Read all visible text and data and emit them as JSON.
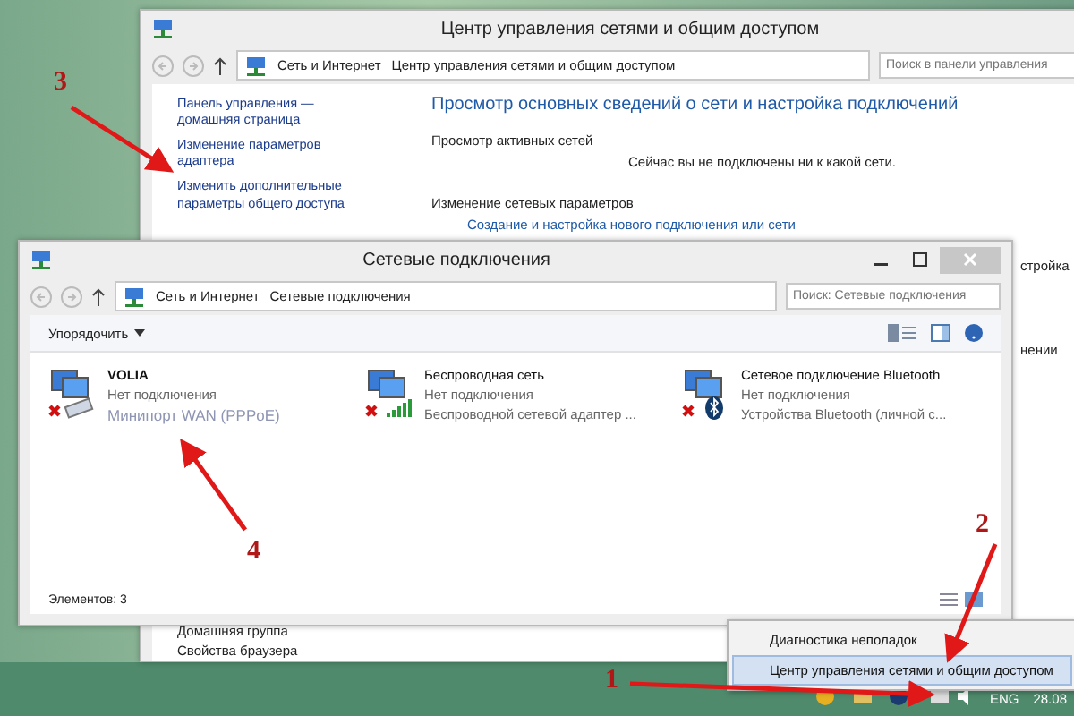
{
  "back_window": {
    "title": "Центр управления сетями и общим доступом",
    "path": [
      "Сеть и Интернет",
      "Центр управления сетями и общим доступом"
    ],
    "search_placeholder": "Поиск в панели управления",
    "sidebar": [
      {
        "label": "Панель управления — домашняя страница"
      },
      {
        "label": "Изменение параметров адаптера"
      },
      {
        "label": "Изменить дополнительные параметры общего доступа"
      }
    ],
    "sidebar_bottom": [
      "Домашняя группа",
      "Свойства браузера"
    ],
    "heading": "Просмотр основных сведений о сети и настройка подключений",
    "active_title": "Просмотр активных сетей",
    "active_text": "Сейчас вы не подключены ни к какой сети.",
    "change_title": "Изменение сетевых параметров",
    "change_link": "Создание и настройка нового подключения или сети",
    "cut_texts": [
      "стройка",
      "нении"
    ]
  },
  "front_window": {
    "title": "Сетевые подключения",
    "path": [
      "Сеть и Интернет",
      "Сетевые подключения"
    ],
    "search_placeholder": "Поиск: Сетевые подключения",
    "organize": "Упорядочить",
    "connections": [
      {
        "name": "VOLIA",
        "status": "Нет подключения",
        "device": "Минипорт WAN (PPPoE)",
        "kind": "wan"
      },
      {
        "name": "Беспроводная сеть",
        "status": "Нет подключения",
        "device": "Беспроводной сетевой адаптер ...",
        "kind": "wireless"
      },
      {
        "name": "Сетевое подключение Bluetooth",
        "status": "Нет подключения",
        "device": "Устройства Bluetooth (личной с...",
        "kind": "bluetooth"
      }
    ],
    "status": "Элементов: 3"
  },
  "context_menu": [
    {
      "label": "Диагностика неполадок",
      "selected": false
    },
    {
      "label": "Центр управления сетями и общим доступом",
      "selected": true
    }
  ],
  "taskbar": {
    "language": "ENG",
    "clock": "28.08"
  },
  "annotations": [
    "1",
    "2",
    "3",
    "4"
  ]
}
